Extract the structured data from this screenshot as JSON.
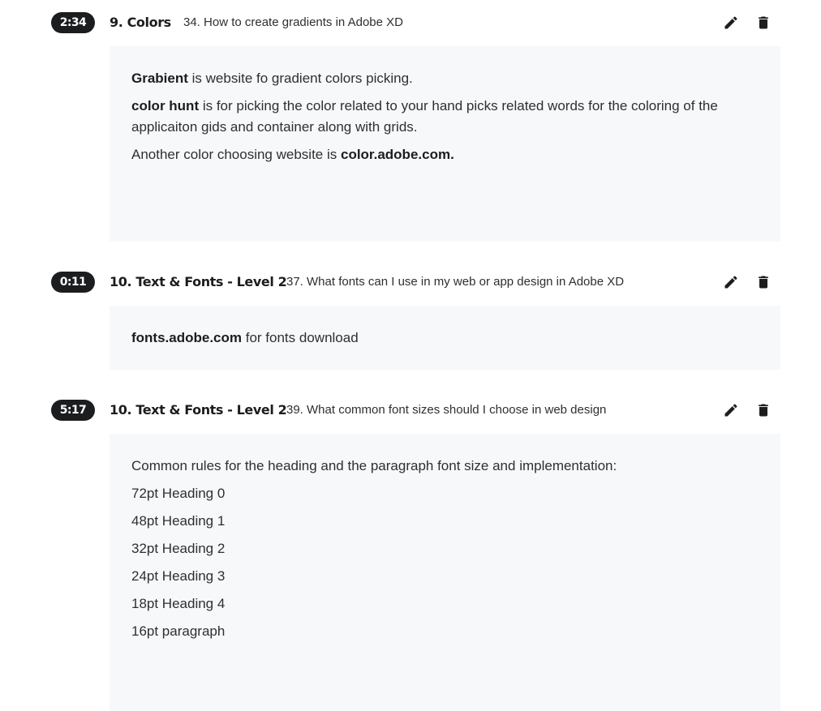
{
  "notes": [
    {
      "time": "2:34",
      "section": "9. Colors",
      "lecture": "34. How to create gradients in Adobe XD",
      "paragraphs": [
        {
          "bold": "Grabient",
          "text": " is website fo gradient colors picking."
        },
        {
          "bold": "color hunt",
          "text": " is for picking the color related to your hand picks related words for the coloring of the applicaiton gids and container along with grids."
        },
        {
          "text": "Another color choosing website is ",
          "bold_end": "color.adobe.com."
        }
      ]
    },
    {
      "time": "0:11",
      "section": "10. Text & Fonts - Level 2",
      "lecture": "37. What fonts can I use in my web or app design in Adobe XD",
      "paragraphs": [
        {
          "bold": "fonts.adobe.com",
          "text": " for fonts download"
        }
      ]
    },
    {
      "time": "5:17",
      "section": "10. Text & Fonts - Level 2",
      "lecture": "39. What common font sizes should I choose in web design",
      "paragraphs": [
        {
          "text": "Common rules for the heading and the paragraph font size and implementation:"
        },
        {
          "text": "72pt Heading 0"
        },
        {
          "text": "48pt Heading 1"
        },
        {
          "text": "32pt Heading 2"
        },
        {
          "text": "24pt Heading 3"
        },
        {
          "text": "18pt Heading 4"
        },
        {
          "text": "16pt paragraph"
        }
      ]
    }
  ],
  "icons": {
    "edit": "pencil-icon",
    "delete": "trash-icon"
  },
  "colors": {
    "badge": "#1c1d1f",
    "body_bg": "#f7f8fa",
    "text": "#2d2f31"
  }
}
